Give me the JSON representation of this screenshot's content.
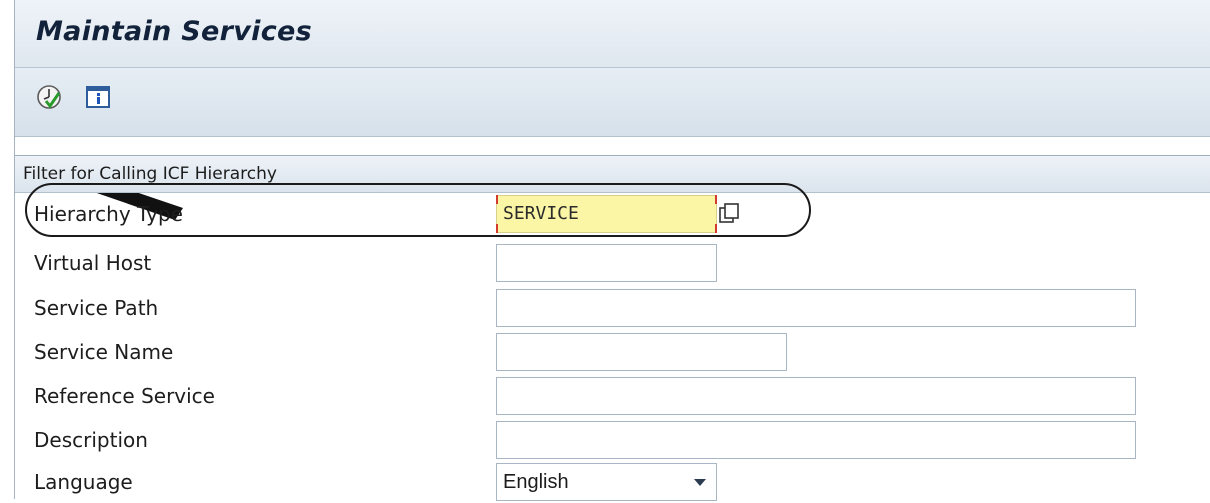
{
  "window": {
    "title": "Maintain Services"
  },
  "toolbar": {
    "buttons": [
      {
        "icon": "execute-icon"
      },
      {
        "icon": "info-icon"
      }
    ]
  },
  "filter": {
    "heading": "Filter for Calling ICF Hierarchy",
    "fields": {
      "hierarchy_type": {
        "label": "Hierarchy Type",
        "value": "SERVICE"
      },
      "virtual_host": {
        "label": "Virtual Host",
        "value": ""
      },
      "service_path": {
        "label": "Service Path",
        "value": ""
      },
      "service_name": {
        "label": "Service Name",
        "value": ""
      },
      "reference_service": {
        "label": "Reference Service",
        "value": ""
      },
      "description": {
        "label": "Description",
        "value": ""
      },
      "language": {
        "label": "Language",
        "value": "English"
      }
    }
  }
}
